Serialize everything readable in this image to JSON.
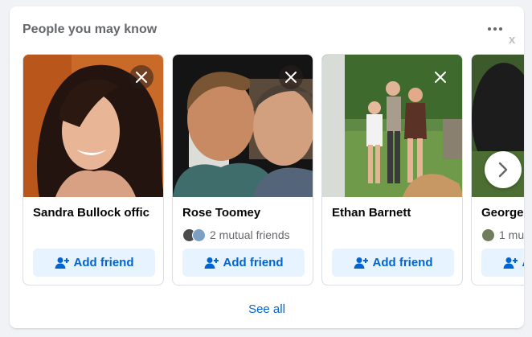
{
  "panel": {
    "title": "People you may know",
    "see_all_label": "See all",
    "dismiss_label": "x"
  },
  "add_friend_label": "Add friend",
  "people": [
    {
      "name": "Sandra Bullock offic",
      "mutual": ""
    },
    {
      "name": "Rose Toomey",
      "mutual": "2 mutual friends"
    },
    {
      "name": "Ethan Barnett",
      "mutual": ""
    },
    {
      "name": "George",
      "mutual": "1 mu"
    }
  ],
  "colors": {
    "accent": "#0064d1",
    "button_bg": "#e7f3ff",
    "secondary_text": "#65676b"
  },
  "icons": [
    "more-icon",
    "close-icon",
    "add-friend-icon",
    "chevron-right-icon"
  ]
}
